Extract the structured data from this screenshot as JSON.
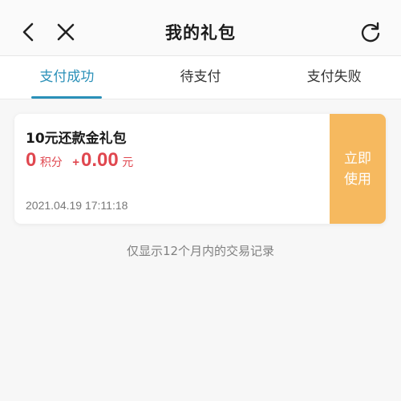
{
  "header": {
    "title": "我的礼包",
    "back_icon": "chevron-left-icon",
    "close_icon": "close-icon",
    "refresh_icon": "refresh-icon"
  },
  "tabs": [
    {
      "label": "支付成功",
      "active": true
    },
    {
      "label": "待支付",
      "active": false
    },
    {
      "label": "支付失败",
      "active": false
    }
  ],
  "card": {
    "title": "10元还款金礼包",
    "points_value": "0",
    "points_unit": "积分",
    "plus": "+",
    "amount_value": "0.00",
    "amount_unit": "元",
    "date": "2021.04.19 17:11:18",
    "use_button_label": "立即使用"
  },
  "note": "仅显示12个月内的交易记录",
  "colors": {
    "accent": "#2a90b8",
    "price": "#e0474f",
    "button": "#f6b95f"
  }
}
